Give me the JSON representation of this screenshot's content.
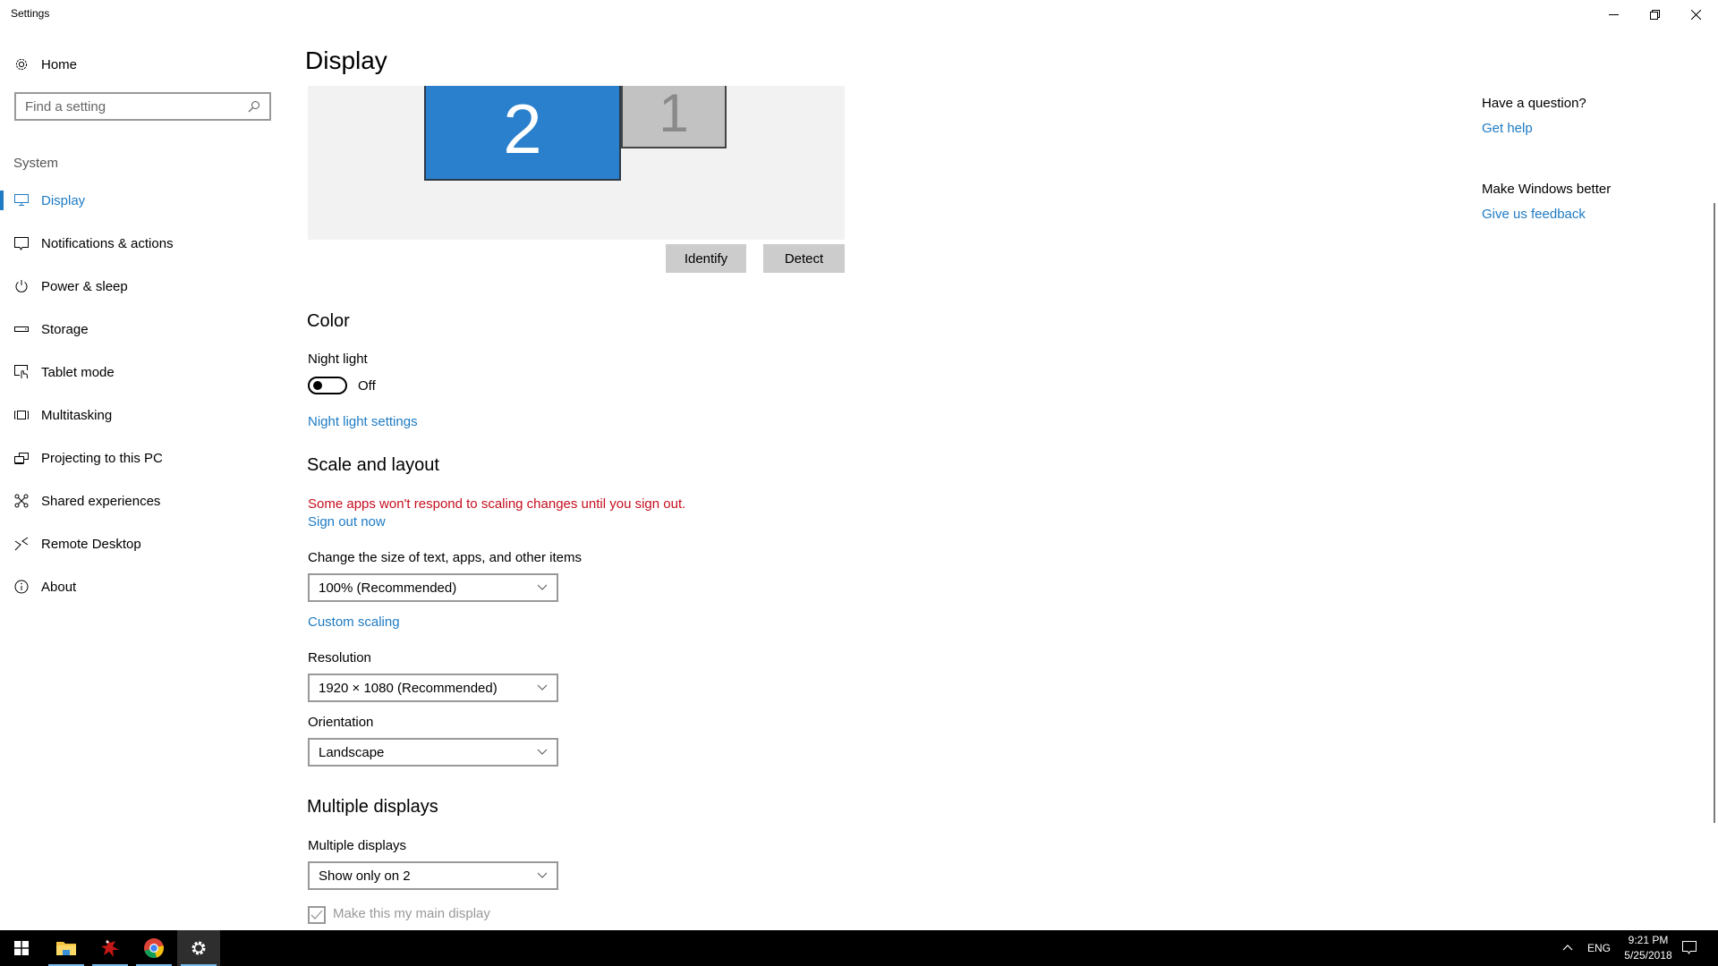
{
  "window": {
    "title": "Settings",
    "controls": {
      "minimize": "minimize-icon",
      "restore": "restore-icon",
      "close": "close-icon"
    }
  },
  "sidebar": {
    "home_label": "Home",
    "search_placeholder": "Find a setting",
    "section_label": "System",
    "items": [
      {
        "label": "Display",
        "icon": "monitor-icon",
        "active": true
      },
      {
        "label": "Notifications & actions",
        "icon": "notification-icon",
        "active": false
      },
      {
        "label": "Power & sleep",
        "icon": "power-icon",
        "active": false
      },
      {
        "label": "Storage",
        "icon": "storage-icon",
        "active": false
      },
      {
        "label": "Tablet mode",
        "icon": "tablet-mode-icon",
        "active": false
      },
      {
        "label": "Multitasking",
        "icon": "multitasking-icon",
        "active": false
      },
      {
        "label": "Projecting to this PC",
        "icon": "projecting-icon",
        "active": false
      },
      {
        "label": "Shared experiences",
        "icon": "shared-experiences-icon",
        "active": false
      },
      {
        "label": "Remote Desktop",
        "icon": "remote-desktop-icon",
        "active": false
      },
      {
        "label": "About",
        "icon": "info-icon",
        "active": false
      }
    ]
  },
  "main": {
    "title": "Display",
    "preview": {
      "monitors": [
        {
          "number": "2",
          "selected": true
        },
        {
          "number": "1",
          "selected": false
        }
      ],
      "identify_label": "Identify",
      "detect_label": "Detect"
    },
    "color": {
      "heading": "Color",
      "night_light_label": "Night light",
      "night_light_state": "Off",
      "night_light_on": false,
      "night_light_settings_link": "Night light settings"
    },
    "scale": {
      "heading": "Scale and layout",
      "warning": "Some apps won't respond to scaling changes until you sign out.",
      "sign_out_link": "Sign out now",
      "size_label": "Change the size of text, apps, and other items",
      "size_value": "100% (Recommended)",
      "custom_scaling_link": "Custom scaling",
      "resolution_label": "Resolution",
      "resolution_value": "1920 × 1080 (Recommended)",
      "orientation_label": "Orientation",
      "orientation_value": "Landscape"
    },
    "multiple": {
      "heading": "Multiple displays",
      "label": "Multiple displays",
      "value": "Show only on 2",
      "main_display_label": "Make this my main display",
      "main_display_checked": true
    }
  },
  "aside": {
    "question_heading": "Have a question?",
    "get_help_link": "Get help",
    "better_heading": "Make Windows better",
    "feedback_link": "Give us feedback"
  },
  "taskbar": {
    "apps": [
      {
        "name": "start",
        "icon": "windows-logo-icon"
      },
      {
        "name": "file-explorer",
        "icon": "folder-icon"
      },
      {
        "name": "red-app",
        "icon": "red-figure-icon"
      },
      {
        "name": "chrome",
        "icon": "chrome-icon"
      },
      {
        "name": "settings",
        "icon": "gear-icon",
        "active": true
      }
    ],
    "tray": {
      "language": "ENG",
      "time": "9:21 PM",
      "date": "5/25/2018"
    }
  },
  "colors": {
    "accent": "#1e7bc4",
    "warning": "#c50f1f",
    "monitor_selected": "#2a80cc",
    "monitor_unselected": "#c2c2c2",
    "button_bg": "#cccccc",
    "taskbar_bg": "#000000"
  }
}
